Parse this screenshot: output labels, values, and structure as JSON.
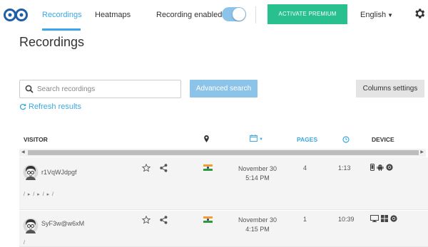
{
  "nav": {
    "tabs": [
      {
        "label": "Recordings",
        "active": true
      },
      {
        "label": "Heatmaps",
        "active": false
      }
    ],
    "recording_label": "Recording enabled",
    "recording_enabled": true,
    "premium_label": "ACTIVATE PREMIUM",
    "language": "English"
  },
  "page": {
    "title": "Recordings",
    "search_placeholder": "Search recordings",
    "advanced_search": "Advanced search",
    "columns_settings": "Columns settings",
    "refresh": "Refresh results"
  },
  "table": {
    "headers": {
      "visitor": "VISITOR",
      "pages": "PAGES",
      "device": "DEVICE"
    },
    "rows": [
      {
        "visitor": "r1VqWJdpgf",
        "date": "November 30",
        "time": "5:14 PM",
        "pages": "4",
        "duration": "1:13",
        "path": "/ ▸ / ▸ / ▸ /",
        "country": "India",
        "device": "mobile",
        "os": "android",
        "browser": "chrome"
      },
      {
        "visitor": "SyF3w@w6xM",
        "date": "November 30",
        "time": "4:15 PM",
        "pages": "1",
        "duration": "10:39",
        "path": "/",
        "country": "India",
        "device": "desktop",
        "os": "windows",
        "browser": "chrome"
      }
    ]
  },
  "colors": {
    "accent": "#3aa8e4",
    "premium": "#27c08e",
    "button_light": "#8cc3e8"
  }
}
